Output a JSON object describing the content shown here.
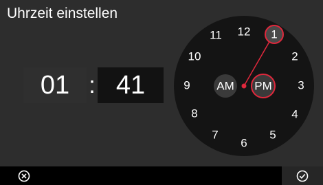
{
  "header": {
    "title": "Uhrzeit einstellen"
  },
  "time": {
    "hour": "01",
    "separator": ":",
    "minute": "41"
  },
  "dial": {
    "numbers": [
      "12",
      "1",
      "2",
      "3",
      "4",
      "5",
      "6",
      "7",
      "8",
      "9",
      "10",
      "11"
    ],
    "selected_hour": "1",
    "am_label": "AM",
    "pm_label": "PM",
    "selected_period": "PM"
  },
  "colors": {
    "background": "#2d2d2d",
    "dial_face": "#141414",
    "accent_red": "#e0283c",
    "selected_fill": "#4a4a4a"
  },
  "footer": {
    "cancel_icon": "cancel-circle-icon",
    "confirm_icon": "check-circle-icon"
  }
}
